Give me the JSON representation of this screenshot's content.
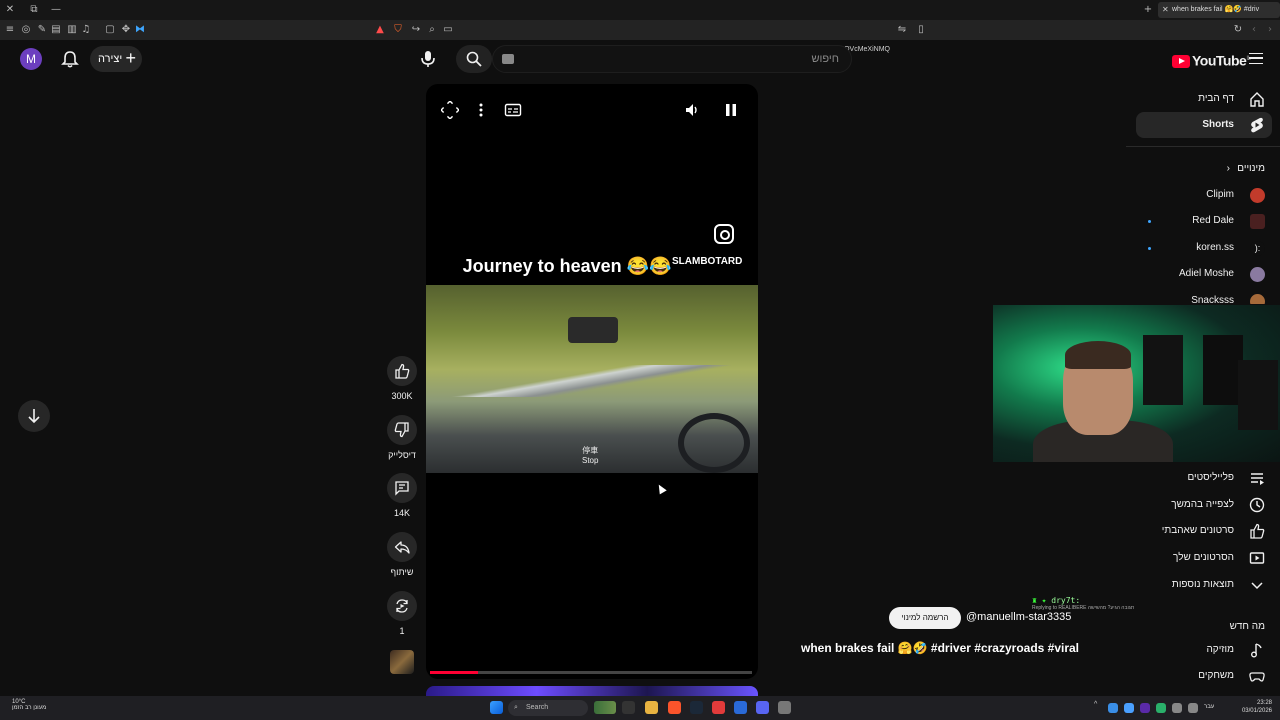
{
  "browser": {
    "tab_title": "when brakes fail 🤗🤣 #driv",
    "url": "youtube.com/shorts/_OVcMeXiNMQ"
  },
  "header": {
    "avatar_letter": "M",
    "create_label": "יצירה",
    "search_placeholder": "חיפוש",
    "logo_text": "YouTube",
    "logo_region": "IL"
  },
  "sidebar": {
    "items": [
      {
        "label": "דף הבית",
        "icon": "home-icon"
      },
      {
        "label": "Shorts",
        "icon": "shorts-icon",
        "active": true
      }
    ],
    "subscriptions_heading": "מינויים",
    "subscriptions": [
      {
        "label": "Clipim",
        "color": "#c23b2b"
      },
      {
        "label": "Red Dale",
        "color": "#4a2020"
      },
      {
        "label": "koren.ss",
        "color": "#222222"
      },
      {
        "label": "Adiel Moshe",
        "color": "#8a7aa0"
      },
      {
        "label": "Snacksss",
        "color": "#a66a3a"
      }
    ],
    "library": [
      {
        "label": "פלייליסטים",
        "icon": "playlist-icon"
      },
      {
        "label": "לצפייה בהמשך",
        "icon": "clock-icon"
      },
      {
        "label": "סרטונים שאהבתי",
        "icon": "thumb-up-icon"
      },
      {
        "label": "הסרטונים שלך",
        "icon": "video-icon"
      },
      {
        "label": "תוצאות נוספות",
        "icon": "chevron-down-icon"
      }
    ],
    "whats_new_heading": "מה חדש",
    "whats_new": [
      {
        "label": "מוזיקה",
        "icon": "music-icon"
      },
      {
        "label": "משחקים",
        "icon": "gamepad-icon"
      }
    ]
  },
  "player": {
    "overlay_title": "Journey to heaven 😂😂",
    "watermark": "SLAMBOTARD",
    "stop_label_cn": "停車",
    "stop_label": "Stop",
    "progress_fraction": 0.15
  },
  "actions": {
    "like_count": "300K",
    "dislike_label": "דיסלייק",
    "comment_count": "14K",
    "share_label": "שיתוף",
    "remix_count": "1"
  },
  "meta": {
    "subscribe_label": "הרשמה למינוי",
    "channel_handle": "@manuellm-star3335",
    "caption": "when brakes fail 🤗🤣 #driver #crazyroads #viral"
  },
  "stream_chat": {
    "user": "dry7t:",
    "reply": "Replying to REALIBERE תגובה הגיע? מהשישה"
  },
  "taskbar": {
    "search_label": "Search",
    "weather_temp": "10°C",
    "weather_desc": "מעונן רב הזמן",
    "time": "23:28",
    "date": "03/01/2026",
    "lang": "עבר"
  }
}
